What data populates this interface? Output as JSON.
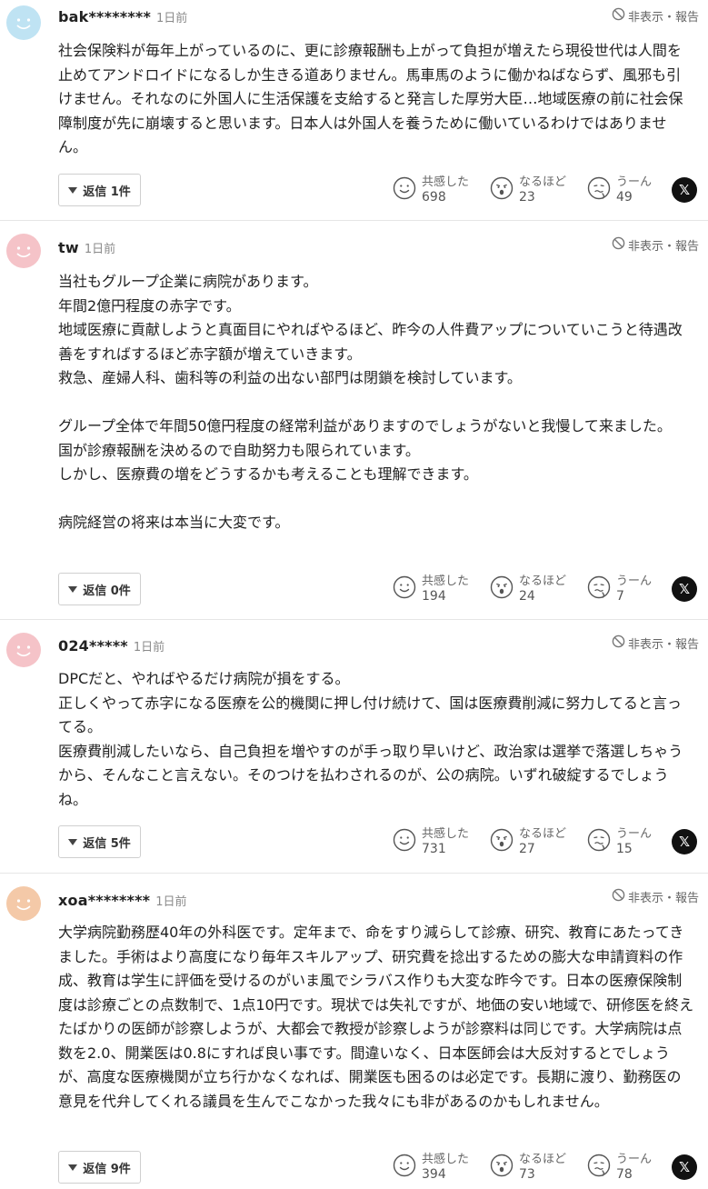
{
  "menu_label": "非表示・報告",
  "reaction_labels": {
    "empathy": "共感した",
    "insight": "なるほど",
    "hmm": "うーん"
  },
  "x_share_label": "𝕏",
  "comments": [
    {
      "user": "bak********",
      "time": "1日前",
      "avatar_color": "#bfe3f3",
      "body": "社会保険料が毎年上がっているのに、更に診療報酬も上がって負担が増えたら現役世代は人間を止めてアンドロイドになるしか生きる道ありません。馬車馬のように働かねばならず、風邪も引けません。それなのに外国人に生活保護を支給すると発言した厚労大臣…地域医療の前に社会保障制度が先に崩壊すると思います。日本人は外国人を養うために働いているわけではありません。",
      "reply": "返信 1件",
      "empathy": "698",
      "insight": "23",
      "hmm": "49"
    },
    {
      "user": "tw",
      "time": "1日前",
      "avatar_color": "#f5c3c8",
      "body": "当社もグループ企業に病院があります。\n年間2億円程度の赤字です。\n地域医療に貢献しようと真面目にやればやるほど、昨今の人件費アップについていこうと待遇改善をすればするほど赤字額が増えていきます。\n救急、産婦人科、歯科等の利益の出ない部門は閉鎖を検討しています。\n\nグループ全体で年間50億円程度の経常利益がありますのでしょうがないと我慢して来ました。\n国が診療報酬を決めるので自助努力も限られています。\nしかし、医療費の増をどうするかも考えることも理解できます。\n\n病院経営の将来は本当に大変です。",
      "reply": "返信 0件",
      "empathy": "194",
      "insight": "24",
      "hmm": "7"
    },
    {
      "user": "024*****",
      "time": "1日前",
      "avatar_color": "#f5c3c8",
      "body": "DPCだと、やればやるだけ病院が損をする。\n正しくやって赤字になる医療を公的機関に押し付け続けて、国は医療費削減に努力してると言ってる。\n医療費削減したいなら、自己負担を増やすのが手っ取り早いけど、政治家は選挙で落選しちゃうから、そんなこと言えない。そのつけを払わされるのが、公の病院。いずれ破綻するでしょうね。",
      "reply": "返信 5件",
      "empathy": "731",
      "insight": "27",
      "hmm": "15"
    },
    {
      "user": "xoa********",
      "time": "1日前",
      "avatar_color": "#f4c9a8",
      "body": "大学病院勤務歴40年の外科医です。定年まで、命をすり減らして診療、研究、教育にあたってきました。手術はより高度になり毎年スキルアップ、研究費を捻出するための膨大な申請資料の作成、教育は学生に評価を受けるのがいま風でシラバス作りも大変な昨今です。日本の医療保険制度は診療ごとの点数制で、1点10円です。現状では失礼ですが、地価の安い地域で、研修医を終えたばかりの医師が診察しようが、大都会で教授が診察しようが診察料は同じです。大学病院は点数を2.0、開業医は0.8にすれば良い事です。間違いなく、日本医師会は大反対するとでしょうが、高度な医療機関が立ち行かなくなれば、開業医も困るのは必定です。長期に渡り、勤務医の意見を代弁してくれる議員を生んでこなかった我々にも非があるのかもしれません。",
      "reply": "返信 9件",
      "empathy": "394",
      "insight": "73",
      "hmm": "78"
    }
  ]
}
